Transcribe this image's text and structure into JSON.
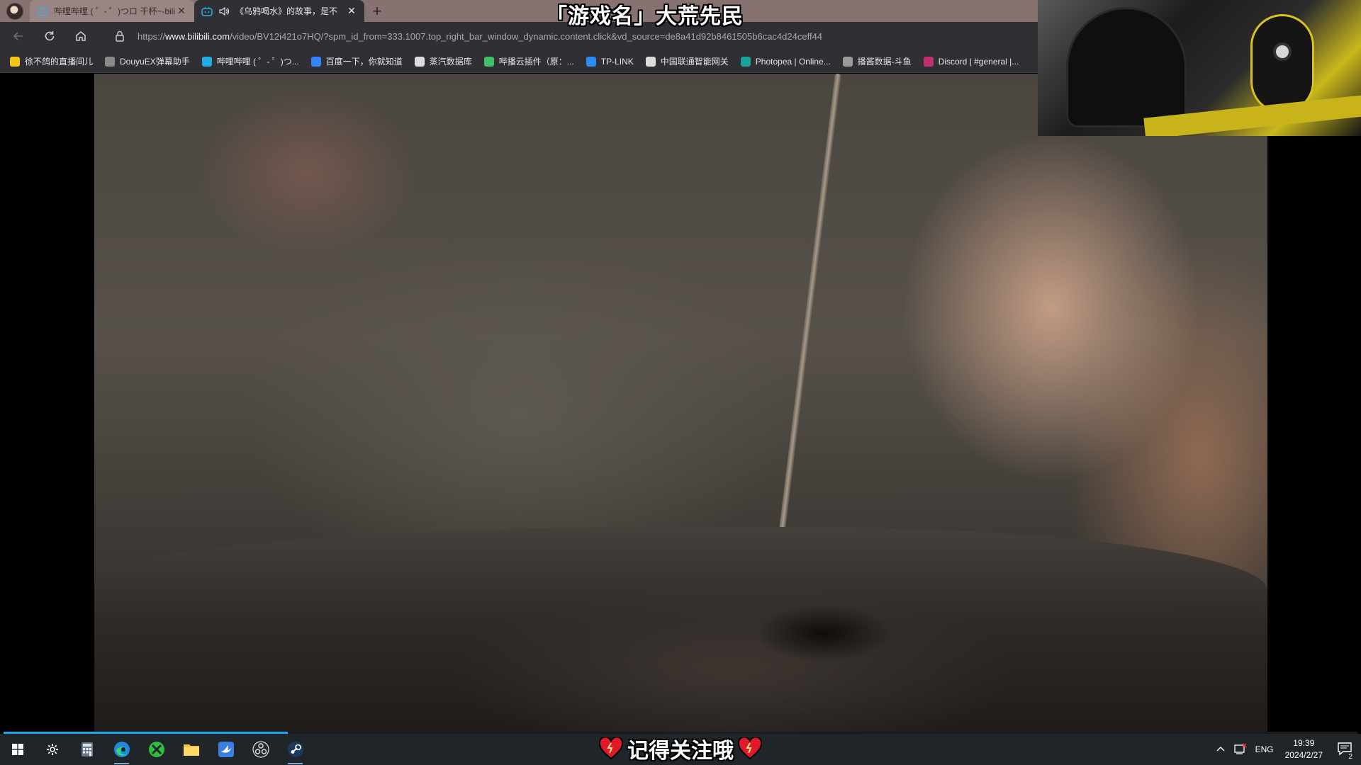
{
  "browser": {
    "tabs": [
      {
        "title": "哔哩哔哩 ( ゜- ゜)つロ 干杯~-bili",
        "active": false
      },
      {
        "title": "《乌鸦喝水》的故事，是不",
        "active": true
      }
    ],
    "new_tab_label": "+",
    "url_prefix": "https://",
    "url_host": "www.bilibili.com",
    "url_path": "/video/BV12i421o7HQ/?spm_id_from=333.1007.top_right_bar_window_dynamic.content.click&vd_source=de8a41d92b8461505b6cac4d24ceff44",
    "bookmarks": [
      {
        "label": "徐不鸽的直播间儿",
        "icon": "bird-icon",
        "color": "#f5c518"
      },
      {
        "label": "DouyuEX弹幕助手",
        "icon": "puzzle-icon",
        "color": "#8a8a8a"
      },
      {
        "label": "哔哩哔哩 ( ゜- ゜)つ...",
        "icon": "bilibili-icon",
        "color": "#23ade5"
      },
      {
        "label": "百度一下，你就知道",
        "icon": "baidu-icon",
        "color": "#3385ff"
      },
      {
        "label": "蒸汽数据库",
        "icon": "database-icon",
        "color": "#dcdcdc"
      },
      {
        "label": "哔播云插件（原：...",
        "icon": "plugin-icon",
        "color": "#3fbf6a"
      },
      {
        "label": "TP-LINK",
        "icon": "tplink-icon",
        "color": "#2a8af6"
      },
      {
        "label": "中国联通智能网关",
        "icon": "page-icon",
        "color": "#dcdcdc"
      },
      {
        "label": "Photopea | Online...",
        "icon": "photopea-icon",
        "color": "#18a497"
      },
      {
        "label": "播酱数据-斗鱼",
        "icon": "globe-icon",
        "color": "#9a9a9a"
      },
      {
        "label": "Discord | #general |...",
        "icon": "discord-icon",
        "color": "#c22f70"
      }
    ]
  },
  "overlay": {
    "stream_title": "「游戏名」大荒先民",
    "follow_text": "记得关注哦"
  },
  "video": {
    "progress_fraction": 0.21
  },
  "taskbar": {
    "apps": [
      {
        "name": "windows-start-icon",
        "running": false
      },
      {
        "name": "settings-gear-icon",
        "running": false
      },
      {
        "name": "calculator-icon",
        "running": false
      },
      {
        "name": "edge-browser-icon",
        "running": true
      },
      {
        "name": "xbox-style-app-icon",
        "running": false
      },
      {
        "name": "file-explorer-icon",
        "running": false
      },
      {
        "name": "bird-app-icon",
        "running": false
      },
      {
        "name": "obs-studio-icon",
        "running": false
      },
      {
        "name": "steam-icon",
        "running": true
      }
    ],
    "language": "ENG",
    "time": "19:39",
    "date": "2024/2/27",
    "notification_count": "2"
  }
}
